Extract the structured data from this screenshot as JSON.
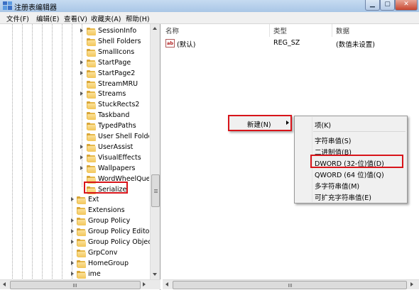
{
  "window": {
    "title": "注册表编辑器"
  },
  "menubar": {
    "items": [
      "文件(F)",
      "编辑(E)",
      "查看(V)",
      "收藏夹(A)",
      "帮助(H)"
    ]
  },
  "tree": {
    "items": [
      {
        "label": "SessionInfo",
        "expander": true
      },
      {
        "label": "Shell Folders",
        "expander": false
      },
      {
        "label": "SmallIcons",
        "expander": false
      },
      {
        "label": "StartPage",
        "expander": true
      },
      {
        "label": "StartPage2",
        "expander": true
      },
      {
        "label": "StreamMRU",
        "expander": false
      },
      {
        "label": "Streams",
        "expander": true
      },
      {
        "label": "StuckRects2",
        "expander": false
      },
      {
        "label": "Taskband",
        "expander": false
      },
      {
        "label": "TypedPaths",
        "expander": false
      },
      {
        "label": "User Shell Folder",
        "expander": false
      },
      {
        "label": "UserAssist",
        "expander": true
      },
      {
        "label": "VisualEffects",
        "expander": true
      },
      {
        "label": "Wallpapers",
        "expander": true
      },
      {
        "label": "WordWheelQuer",
        "expander": false
      },
      {
        "label": "Serialize",
        "expander": false,
        "selected": true
      },
      {
        "label": "Ext",
        "expander": true
      },
      {
        "label": "Extensions",
        "expander": false
      },
      {
        "label": "Group Policy",
        "expander": true
      },
      {
        "label": "Group Policy Editor",
        "expander": true
      },
      {
        "label": "Group Policy Object",
        "expander": true
      },
      {
        "label": "GrpConv",
        "expander": false
      },
      {
        "label": "HomeGroup",
        "expander": true
      },
      {
        "label": "ime",
        "expander": true
      }
    ]
  },
  "list": {
    "columns": [
      "名称",
      "类型",
      "数据"
    ],
    "rows": [
      {
        "name": "(默认)",
        "type": "REG_SZ",
        "data": "(数值未设置)"
      }
    ]
  },
  "context_menu": {
    "new_label": "新建(N)",
    "submenu": [
      "项(K)",
      "字符串值(S)",
      "二进制值(B)",
      "DWORD (32-位)值(D)",
      "QWORD (64 位)值(Q)",
      "多字符串值(M)",
      "可扩充字符串值(E)"
    ],
    "highlighted_item": "DWORD (32-位)值(D)"
  },
  "colors": {
    "highlight_border": "#d8141a",
    "folder": "#f2c65a",
    "menu_bg": "#f0f0f0"
  }
}
